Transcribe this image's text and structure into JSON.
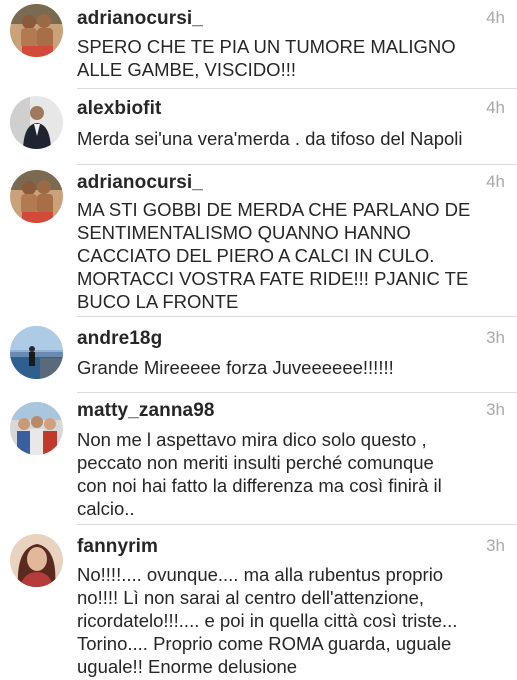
{
  "comments": [
    {
      "username": "adrianocursi_",
      "time": "4h",
      "text": "SPERO CHE TE PIA UN TUMORE MALIGNO\nALLE GAMBE, VISCIDO!!!"
    },
    {
      "username": "alexbiofit",
      "time": "4h",
      "text": "Merda sei'una vera'merda . da tifoso del Napoli"
    },
    {
      "username": "adrianocursi_",
      "time": "4h",
      "text": "MA STI GOBBI DE MERDA CHE PARLANO DE\nSENTIMENTALISMO QUANNO HANNO\nCACCIATO DEL PIERO A CALCI IN CULO.\nMORTACCI VOSTRA FATE RIDE!!! PJANIC TE\nBUCO LA FRONTE"
    },
    {
      "username": "andre18g",
      "time": "3h",
      "text": "Grande Mireeeee forza Juveeeeee!!!!!!"
    },
    {
      "username": "matty_zanna98",
      "time": "3h",
      "text": "Non me l aspettavo mira dico solo questo ,\npeccato non meriti insulti perché comunque\ncon noi hai fatto la differenza ma così finirà il\ncalcio.."
    },
    {
      "username": "fannyrim",
      "time": "3h",
      "text": "No!!!!.... ovunque.... ma alla rubentus proprio\nno!!!! Lì non sarai al centro dell'attenzione,\nricordatelo!!!.... e poi in quella città così triste...\nTorino.... Proprio come ROMA guarda,  uguale\nuguale!! Enorme delusione"
    }
  ]
}
